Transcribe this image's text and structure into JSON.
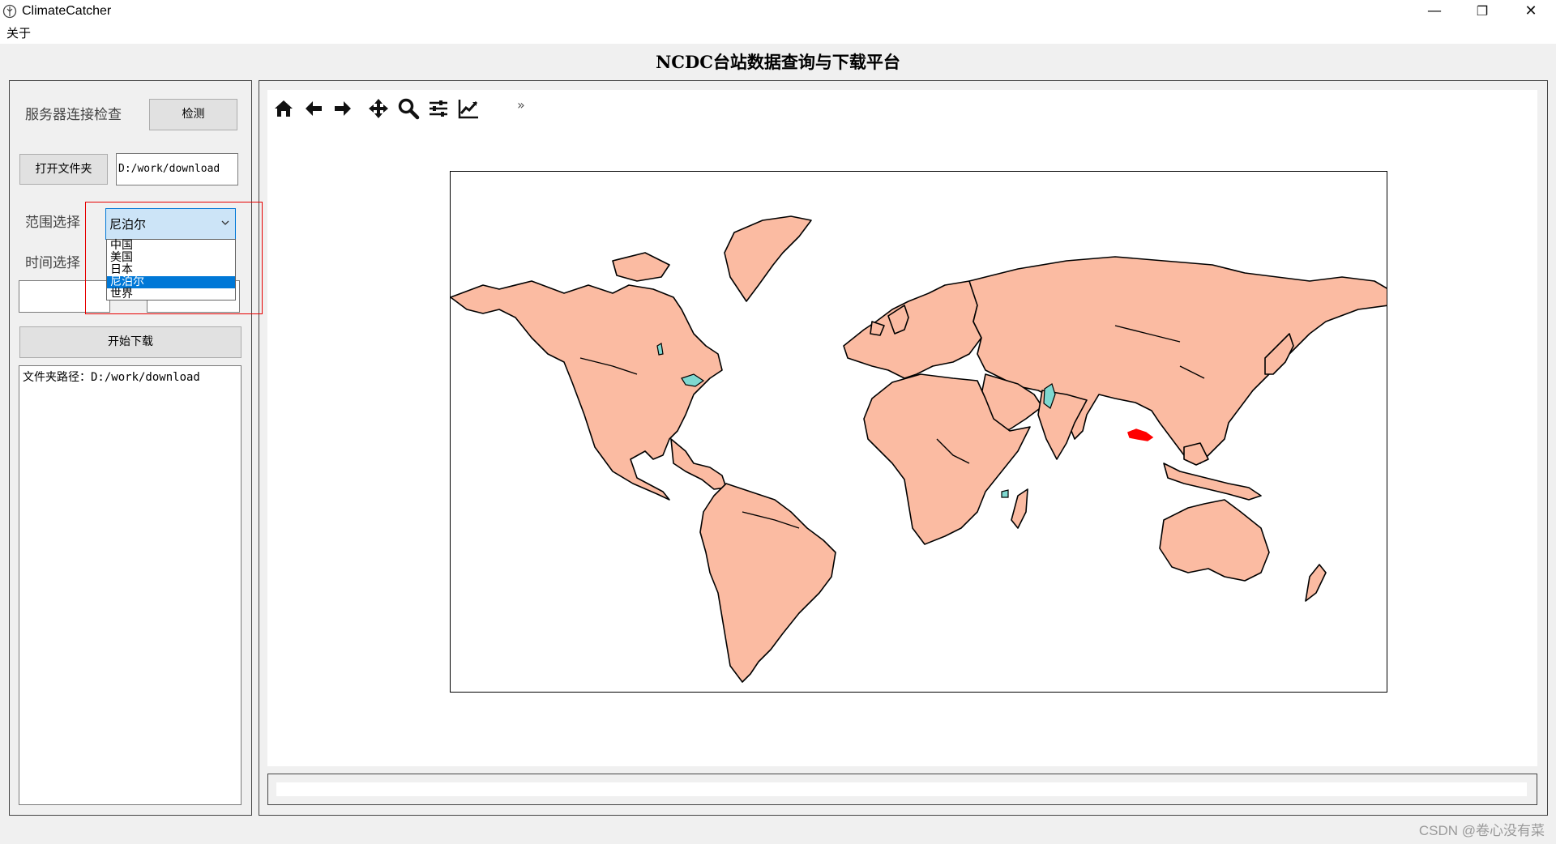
{
  "window": {
    "title": "ClimateCatcher",
    "minimize": "—",
    "restore": "❐",
    "close": "✕"
  },
  "menu": {
    "about": "关于"
  },
  "main_title": "NCDC台站数据查询与下载平台",
  "left": {
    "server_check_label": "服务器连接检查",
    "detect_button": "检测",
    "open_folder_button": "打开文件夹",
    "folder_path_value": "D:/work/download",
    "range_label": "范围选择",
    "range_selected": "尼泊尔",
    "range_options": [
      "中国",
      "美国",
      "日本",
      "尼泊尔",
      "世界"
    ],
    "time_label": "时间选择",
    "time_start_value": "",
    "time_end_value": "",
    "start_download_button": "开始下载",
    "log_text": "文件夹路径：D:/work/download"
  },
  "toolbar": {
    "icons": [
      "home-icon",
      "back-icon",
      "forward-icon",
      "pan-icon",
      "zoom-icon",
      "configure-subplots-icon",
      "edit-axis-icon"
    ],
    "more": "»"
  },
  "map": {
    "land_color": "#fbbba2",
    "lake_color": "#7fd8d0",
    "highlight_color": "#ff0000",
    "highlight_region": "尼泊尔"
  },
  "status_text": "",
  "watermark": "CSDN @卷心没有菜"
}
